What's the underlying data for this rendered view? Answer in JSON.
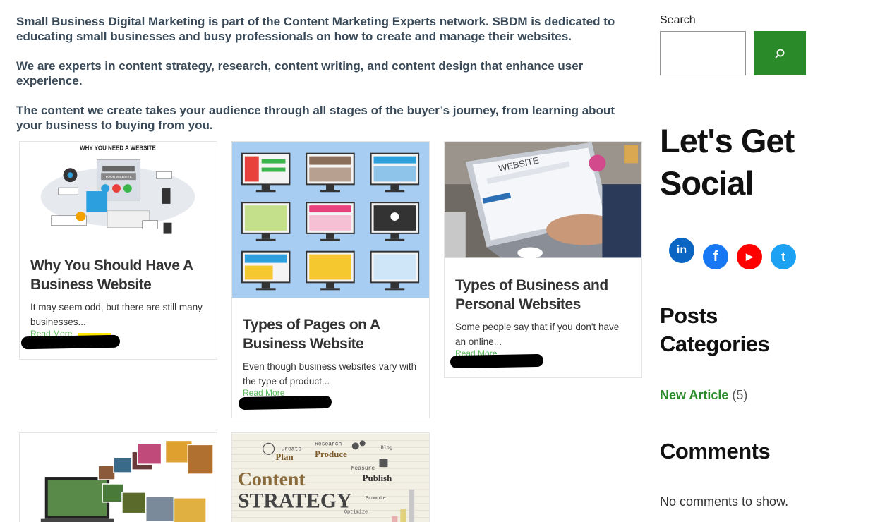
{
  "intro": {
    "paragraphs": [
      "Small Business Digital Marketing is part of the Content Marketing Experts network. SBDM is dedicated to educating small businesses and busy professionals on how to create and manage their websites.",
      "We are experts in content strategy, research, content writing, and content design that enhance user experience.",
      "The content we create takes your audience through all stages of the buyer’s journey, from learning about your business to buying from you."
    ]
  },
  "posts": [
    {
      "title": "Why You Should Have A Business Website",
      "excerpt": "It may seem odd, but there are still many businesses...",
      "read_more": "Read More",
      "image_caption": "WHY YOU NEED A WEBSITE",
      "image_labels": [
        "YOUR WEBSITE"
      ]
    },
    {
      "title": "Types of Pages on A Business Website",
      "excerpt": "Even though business websites vary with the type of product...",
      "read_more": "Read More"
    },
    {
      "title": "Types of Business and Personal Websites",
      "excerpt": "Some people say that if you don't have an online...",
      "read_more": "Read More",
      "image_caption": "WEBSITE"
    },
    {
      "image_kind": "photo gallery"
    },
    {
      "image_words": [
        "Create",
        "Plan",
        "Research",
        "Produce",
        "Measure",
        "Publish",
        "Content",
        "STRATEGY",
        "Promote",
        "Optimize",
        "Blog"
      ]
    }
  ],
  "sidebar": {
    "search_label": "Search",
    "search_placeholder": "",
    "search_icon": "search-icon",
    "social_title": "Let's Get Social",
    "social_links": [
      {
        "name": "linkedin-icon",
        "glyph": "in",
        "color": "#0a66c2"
      },
      {
        "name": "facebook-icon",
        "glyph": "f",
        "color": "#1877f2"
      },
      {
        "name": "youtube-icon",
        "glyph": "▶",
        "color": "#ff0000"
      },
      {
        "name": "twitter-icon",
        "glyph": "t",
        "color": "#1da1f2"
      }
    ],
    "categories_title": "Posts Categories",
    "categories": [
      {
        "label": "New Article",
        "count": "(5)"
      }
    ],
    "comments_title": "Comments",
    "no_comments": "No comments to show."
  },
  "colors": {
    "accent_green": "#2a8a2a",
    "read_more_green": "#5cb85c",
    "intro_text": "#3a4a58"
  }
}
